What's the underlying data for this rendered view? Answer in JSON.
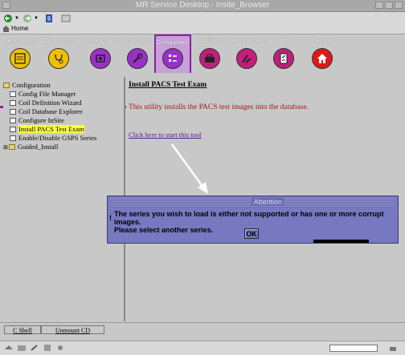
{
  "window": {
    "title": "MR Service Desktop - Insite_Browser"
  },
  "browser": {
    "home_label": "Home"
  },
  "tabs": [
    {
      "label": "Error Logs",
      "color": "#f0c000",
      "icon": "list-icon"
    },
    {
      "label": "Diagnostics",
      "color": "#f0c000",
      "icon": "stethoscope-icon"
    },
    {
      "label": "Image Quality",
      "color": "#9a30c8",
      "icon": "scanner-icon"
    },
    {
      "label": "Calibration",
      "color": "#9a30c8",
      "icon": "wrench-icon"
    },
    {
      "label": "Configuration",
      "color": "#9a30c8",
      "icon": "config-icon",
      "active": true
    },
    {
      "label": "Utilities",
      "color": "#c0207a",
      "icon": "toolbox-icon"
    },
    {
      "label": "Replacement",
      "color": "#c0207a",
      "icon": "tools-icon"
    },
    {
      "label": "PM",
      "color": "#c0207a",
      "icon": "checklist-icon"
    },
    {
      "label": "Home",
      "color": "#c0207a",
      "icon": "house-icon"
    }
  ],
  "tree": {
    "root": "Configuration",
    "items": [
      {
        "label": "Config File Manager"
      },
      {
        "label": "Coil Definition Wizard"
      },
      {
        "label": "Coil Database Explorer"
      },
      {
        "label": "Configure InSite"
      },
      {
        "label": "Install PACS Test Exam",
        "selected": true
      },
      {
        "label": "Enable/Disable GSPS Series"
      },
      {
        "label": "Guided_Install",
        "folder": true
      }
    ]
  },
  "main": {
    "title": "Install PACS Test Exam",
    "description": "This utility installs the PACS test images into the database.",
    "link": "Click here to start this tool"
  },
  "dialog": {
    "title": "Attention",
    "line1": "The series you wish to load is either not supported or has one or more corrupt images.",
    "line2": "Please select another series.",
    "ok_label": "OK"
  },
  "bottom": {
    "cshell": "C Shell",
    "unmount": "Unmount CD"
  },
  "colors": {
    "accent": "#8a1fa8",
    "dialog": "#7878c0",
    "selection": "#ffff40"
  }
}
